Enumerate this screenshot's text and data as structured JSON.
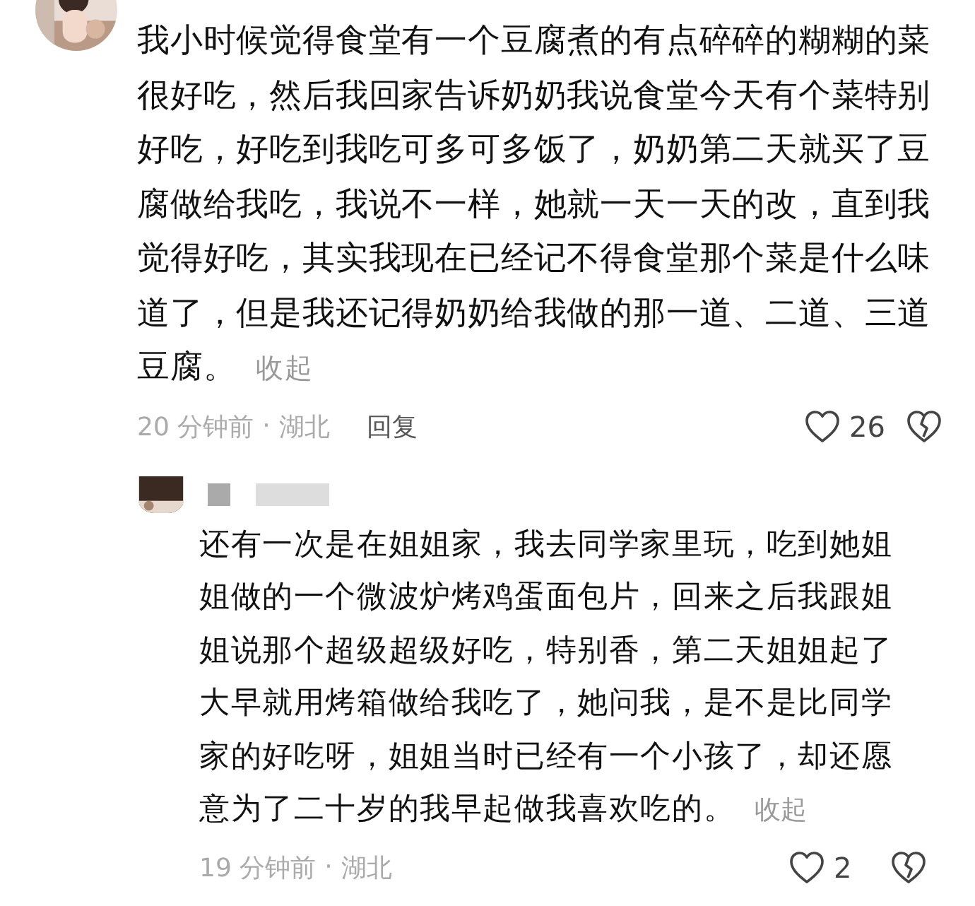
{
  "comments": [
    {
      "text": "我小时候觉得食堂有一个豆腐煮的有点碎碎的糊糊的菜很好吃，然后我回家告诉奶奶我说食堂今天有个菜特别好吃，好吃到我吃可多可多饭了，奶奶第二天就买了豆腐做给我吃，我说不一样，她就一天一天的改，直到我觉得好吃，其实我现在已经记不得食堂那个菜是什么味道了，但是我还记得奶奶给我做的那一道、二道、三道豆腐。",
      "collapse": "收起",
      "time": "20 分钟前",
      "separator": "·",
      "location": "湖北",
      "reply": "回复",
      "likes": "26",
      "replies": [
        {
          "text": "还有一次是在姐姐家，我去同学家里玩，吃到她姐姐做的一个微波炉烤鸡蛋面包片，回来之后我跟姐姐说那个超级超级好吃，特别香，第二天姐姐起了大早就用烤箱做给我吃了，她问我，是不是比同学家的好吃呀，姐姐当时已经有一个小孩了，却还愿意为了二十岁的我早起做我喜欢吃的。",
          "collapse": "收起",
          "time": "19 分钟前",
          "separator": "·",
          "location": "湖北",
          "likes": "2"
        }
      ]
    }
  ]
}
